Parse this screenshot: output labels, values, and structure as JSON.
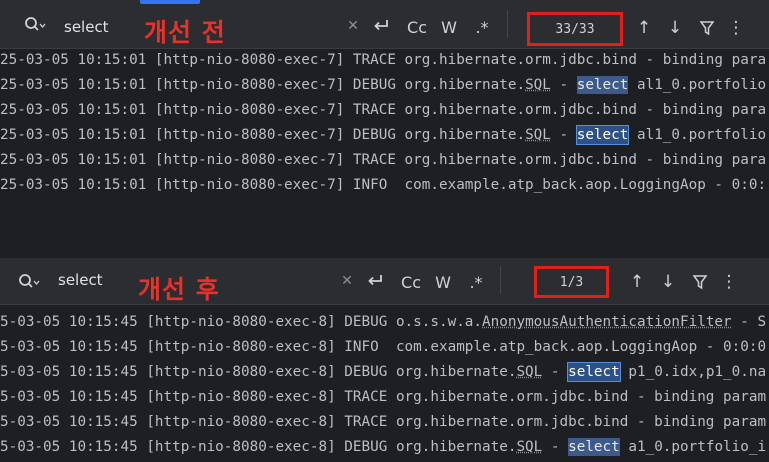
{
  "top": {
    "query": "select",
    "annotation": "개선 전",
    "counter": "33/33",
    "options": {
      "case": "Cc",
      "word": "W",
      "regex": ".*"
    },
    "lines": [
      [
        "25-03-05 10:15:01 [http-nio-8080-exec-7] TRACE org.hibernate.orm.jdbc.bind - binding para"
      ],
      [
        "25-03-05 10:15:01 [http-nio-8080-exec-7] DEBUG org.hibernate.",
        "SQL",
        " - ",
        "select",
        " al1_0.portfolio"
      ],
      [
        "25-03-05 10:15:01 [http-nio-8080-exec-7] TRACE org.hibernate.orm.jdbc.bind - binding para"
      ],
      [
        "25-03-05 10:15:01 [http-nio-8080-exec-7] DEBUG org.hibernate.",
        "SQL",
        " - ",
        "select",
        " al1_0.portfolio"
      ],
      [
        "25-03-05 10:15:01 [http-nio-8080-exec-7] TRACE org.hibernate.orm.jdbc.bind - binding para"
      ],
      [
        "25-03-05 10:15:01 [http-nio-8080-exec-7] INFO  com.example.atp_back.aop.LoggingAop - 0:0:"
      ]
    ]
  },
  "bottom": {
    "query": "select",
    "annotation": "개선 후",
    "counter": "1/3",
    "options": {
      "case": "Cc",
      "word": "W",
      "regex": ".*"
    },
    "lines": [
      [
        "5-03-05 10:15:45 [http-nio-8080-exec-8] DEBUG o.s.s.w.a.",
        "AnonymousAuthenticationFilter",
        " - S"
      ],
      [
        "5-03-05 10:15:45 [http-nio-8080-exec-8] INFO  com.example.atp_back.aop.LoggingAop - 0:0:0"
      ],
      [
        "5-03-05 10:15:45 [http-nio-8080-exec-8] DEBUG org.hibernate.",
        "SQL",
        " - ",
        "select",
        " p1_0.idx,p1_0.na"
      ],
      [
        "5-03-05 10:15:45 [http-nio-8080-exec-8] TRACE org.hibernate.orm.jdbc.bind - binding param"
      ],
      [
        "5-03-05 10:15:45 [http-nio-8080-exec-8] TRACE org.hibernate.orm.jdbc.bind - binding param"
      ],
      [
        "5-03-05 10:15:45 [http-nio-8080-exec-8] DEBUG org.hibernate.",
        "SQL",
        " - ",
        "select",
        " a1_0.portfolio_i"
      ]
    ]
  },
  "icons": [
    "search-icon",
    "clear-icon",
    "replace-icon",
    "prev-match-icon",
    "next-match-icon",
    "filter-icon",
    "more-icon"
  ],
  "colors": {
    "annotation": "#e8312b",
    "counter_box": "#e0201b",
    "highlight": "#3d5a8a",
    "accent": "#3574f0"
  }
}
